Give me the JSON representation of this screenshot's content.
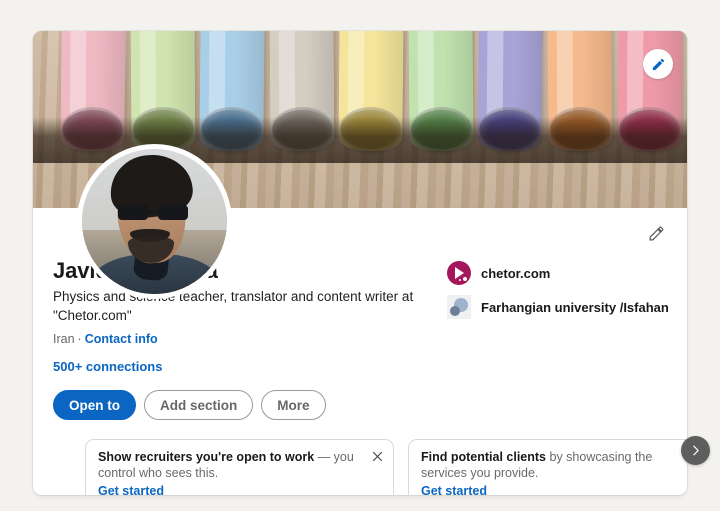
{
  "theme": {
    "background": "#f4f2ee",
    "card_background": "#ffffff",
    "accent": "#0a66c2",
    "text_primary": "#000000e6",
    "text_secondary": "#00000099",
    "chetor_logo_color": "#a4175a",
    "carousel_button_color": "#5e5e5e"
  },
  "banner": {
    "description": "colored-chalk-sticks-on-wood",
    "edit_icon": "pencil-icon",
    "chalk_colors": [
      "#efb9c2",
      "#cfe4ae",
      "#a9cfe8",
      "#d3cdc2",
      "#f4e59b",
      "#bfe2ae",
      "#a9a4d8",
      "#f4b98c",
      "#ef9aa8"
    ],
    "chalk_tip_colors": [
      "#a65d72",
      "#8faa5c",
      "#5e91bd",
      "#8d8478",
      "#cbb04a",
      "#6aa85c",
      "#5a53a3",
      "#c4732f",
      "#bb3a5e"
    ]
  },
  "avatar": {
    "alt": "profile photo of man wearing sunglasses",
    "name": "avatar"
  },
  "profile": {
    "name": "Javid Farjamnia",
    "headline": "Physics and science teacher, translator and content writer at \"Chetor.com\"",
    "location": "Iran",
    "separator": "·",
    "contact_info_label": "Contact info",
    "connections": "500+ connections",
    "edit_icon": "pencil-icon"
  },
  "affiliations": [
    {
      "label": "chetor.com",
      "icon": "chetor-logo-icon"
    },
    {
      "label": "Farhangian university /Isfahan",
      "icon": "university-logo-icon"
    }
  ],
  "actions": [
    {
      "label": "Open to",
      "style": "primary",
      "name": "open-to-button"
    },
    {
      "label": "Add section",
      "style": "outline",
      "name": "add-section-button"
    },
    {
      "label": "More",
      "style": "outline",
      "name": "more-button"
    }
  ],
  "promos": [
    {
      "bold": "Show recruiters you're open to work",
      "rest": " — you control who sees this.",
      "cta": "Get started",
      "close_icon": "close-icon"
    },
    {
      "bold": "Find potential clients",
      "rest": " by showcasing the services you provide.",
      "cta": "Get started",
      "close_icon": "close-icon"
    }
  ],
  "carousel": {
    "next_icon": "chevron-right-icon",
    "next_label": "Next"
  }
}
